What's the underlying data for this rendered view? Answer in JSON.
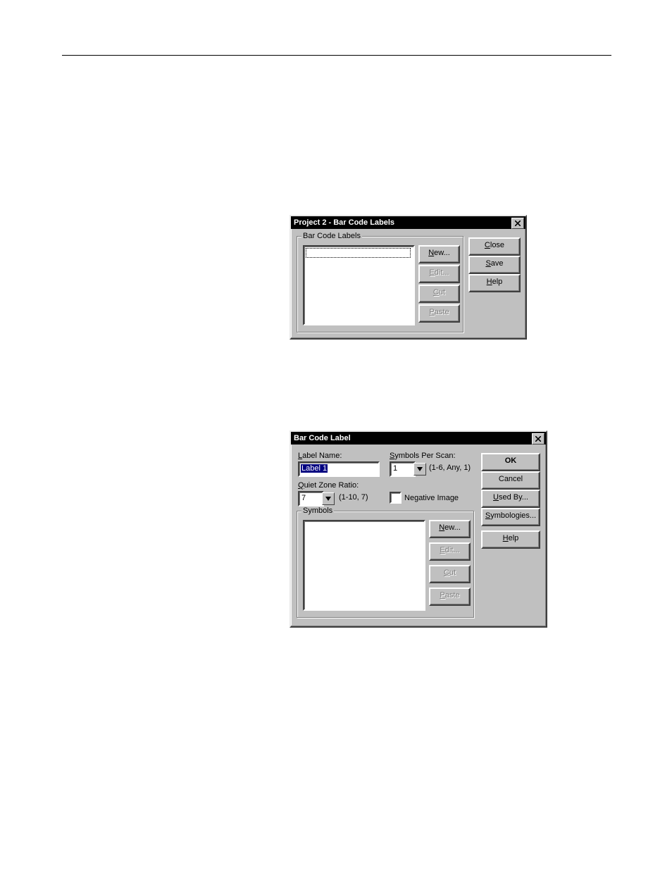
{
  "dialog1": {
    "title": "Project 2 - Bar Code Labels",
    "group_label_prefix": "B",
    "group_label_rest": "ar Code Labels",
    "buttons": {
      "new_u": "N",
      "new_rest": "ew...",
      "edit_u": "E",
      "edit_rest": "dit...",
      "cut_u": "C",
      "cut_rest": "ut",
      "paste_u": "P",
      "paste_rest": "aste",
      "close_u": "C",
      "close_rest": "lose",
      "save_u": "S",
      "save_rest": "ave",
      "help_u": "H",
      "help_rest": "elp"
    }
  },
  "dialog2": {
    "title": "Bar Code Label",
    "label_name_u": "L",
    "label_name_rest": "abel Name:",
    "label_name_value": "Label 1",
    "symbols_per_scan_u": "S",
    "symbols_per_scan_rest": "ymbols Per Scan:",
    "symbols_per_scan_value": "1",
    "symbols_per_scan_hint": "(1-6, Any, 1)",
    "quiet_zone_u": "Q",
    "quiet_zone_rest": "uiet Zone Ratio:",
    "quiet_zone_value": "7",
    "quiet_zone_hint": "(1-10, 7)",
    "negative_image_u": "N",
    "negative_image_rest": "egative Image",
    "group_symbols_u": "S",
    "group_symbols_rest": "ymbols",
    "buttons": {
      "new_u": "N",
      "new_rest": "ew...",
      "edit_u": "E",
      "edit_rest": "dit...",
      "cut_u": "C",
      "cut_rest": "ut",
      "paste_u": "P",
      "paste_rest": "aste",
      "ok": "OK",
      "cancel": "Cancel",
      "usedby_u": "U",
      "usedby_rest": "sed By...",
      "symbologies_u": "S",
      "symbologies_rest": "ymbologies...",
      "help_u": "H",
      "help_rest": "elp"
    }
  }
}
